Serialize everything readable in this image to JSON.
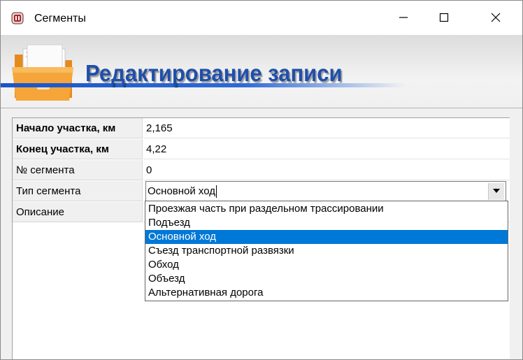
{
  "window": {
    "title": "Сегменты",
    "icons": {
      "app": "app-logo-icon",
      "minimize": "minimize-icon",
      "maximize": "maximize-icon",
      "close": "close-icon"
    }
  },
  "banner": {
    "title": "Редактирование записи",
    "icon": "folder-icon"
  },
  "fields": [
    {
      "label": "Начало участка, км",
      "value": "2,165",
      "bold": true
    },
    {
      "label": "Конец участка, км",
      "value": "4,22",
      "bold": true
    },
    {
      "label": "№ сегмента",
      "value": "0",
      "bold": false
    },
    {
      "label": "Тип сегмента",
      "value": "Основной ход",
      "bold": false
    },
    {
      "label": "Описание",
      "value": "",
      "bold": false
    }
  ],
  "segment_type_dropdown": {
    "selected": "Основной ход",
    "options": [
      "Проезжая часть при раздельном трассировании",
      "Подъезд",
      "Основной ход",
      "Съезд транспортной развязки",
      "Обход",
      "Объезд",
      "Альтернативная дорога"
    ],
    "highlight_color": "#0078d7"
  },
  "colors": {
    "banner_title": "#1f4faa",
    "accent_line": "#1a55c9"
  }
}
